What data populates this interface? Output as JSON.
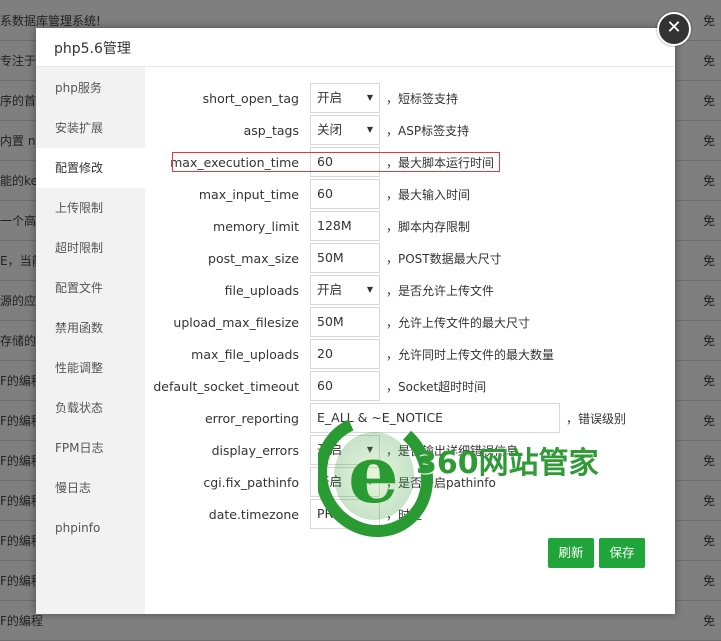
{
  "background": {
    "rows": [
      {
        "left": "系数据库管理系统!",
        "right": "免"
      },
      {
        "left": "专注于",
        "right": "免"
      },
      {
        "left": "序的首",
        "right": "免"
      },
      {
        "left": "内置 no",
        "right": "免"
      },
      {
        "left": "能的ke",
        "right": "免"
      },
      {
        "left": "一个高性",
        "right": "免"
      },
      {
        "left": "E，当前",
        "right": "免"
      },
      {
        "left": "源的应",
        "right": "免"
      },
      {
        "left": "存储的数",
        "right": "免"
      },
      {
        "left": "F的编程",
        "right": "免"
      },
      {
        "left": "F的编程",
        "right": "免"
      },
      {
        "left": "F的编程",
        "right": "免"
      },
      {
        "left": "F的编程",
        "right": "免"
      },
      {
        "left": "F的编程",
        "right": "免"
      },
      {
        "left": "F的编程",
        "right": "免"
      },
      {
        "left": "F的编程",
        "right": "免"
      }
    ]
  },
  "modal": {
    "title": "php5.6管理",
    "close_symbol": "✕",
    "sidebar": [
      {
        "label": "php服务",
        "active": false
      },
      {
        "label": "安装扩展",
        "active": false
      },
      {
        "label": "配置修改",
        "active": true
      },
      {
        "label": "上传限制",
        "active": false
      },
      {
        "label": "超时限制",
        "active": false
      },
      {
        "label": "配置文件",
        "active": false
      },
      {
        "label": "禁用函数",
        "active": false
      },
      {
        "label": "性能调整",
        "active": false
      },
      {
        "label": "负载状态",
        "active": false
      },
      {
        "label": "FPM日志",
        "active": false
      },
      {
        "label": "慢日志",
        "active": false
      },
      {
        "label": "phpinfo",
        "active": false
      }
    ],
    "settings": [
      {
        "key": "short_open_tag",
        "value": "开启",
        "kind": "select",
        "desc": "，短标签支持"
      },
      {
        "key": "asp_tags",
        "value": "关闭",
        "kind": "select",
        "desc": "，ASP标签支持"
      },
      {
        "key": "max_execution_time",
        "value": "60",
        "kind": "text",
        "desc": "，最大脚本运行时间"
      },
      {
        "key": "max_input_time",
        "value": "60",
        "kind": "text",
        "desc": "，最大输入时间"
      },
      {
        "key": "memory_limit",
        "value": "128M",
        "kind": "text",
        "desc": "，脚本内存限制"
      },
      {
        "key": "post_max_size",
        "value": "50M",
        "kind": "text",
        "desc": "，POST数据最大尺寸"
      },
      {
        "key": "file_uploads",
        "value": "开启",
        "kind": "select",
        "desc": "，是否允许上传文件"
      },
      {
        "key": "upload_max_filesize",
        "value": "50M",
        "kind": "text",
        "desc": "，允许上传文件的最大尺寸"
      },
      {
        "key": "max_file_uploads",
        "value": "20",
        "kind": "text",
        "desc": "，允许同时上传文件的最大数量"
      },
      {
        "key": "default_socket_timeout",
        "value": "60",
        "kind": "text",
        "desc": "，Socket超时时间"
      },
      {
        "key": "error_reporting",
        "value": "E_ALL & ~E_NOTICE",
        "kind": "wide",
        "desc": "，错误级别"
      },
      {
        "key": "display_errors",
        "value": "开启",
        "kind": "select",
        "desc": "，是否输出详细错误信息"
      },
      {
        "key": "cgi.fix_pathinfo",
        "value": "开启",
        "kind": "select",
        "desc": "，是否开启pathinfo"
      },
      {
        "key": "date.timezone",
        "value": "PRC",
        "kind": "text",
        "desc": "，时区"
      }
    ],
    "buttons": {
      "refresh": "刷新",
      "save": "保存"
    },
    "caret": "▼"
  },
  "watermark": {
    "text": "360网站管家",
    "letter": "e"
  },
  "colors": {
    "accent": "#20a53a",
    "highlight": "#e03a3a"
  }
}
